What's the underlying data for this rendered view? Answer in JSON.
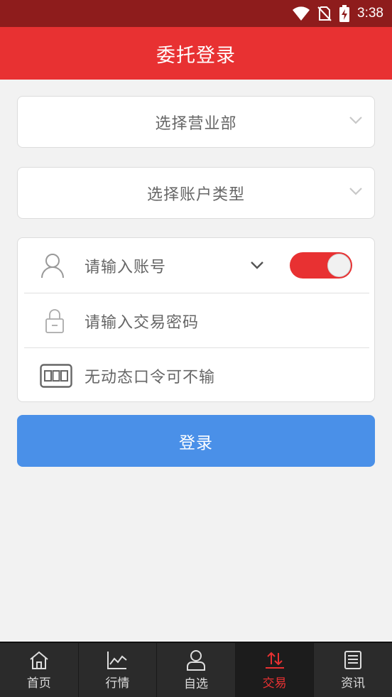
{
  "status_bar": {
    "time": "3:38"
  },
  "header": {
    "title": "委托登录"
  },
  "branch_select": {
    "label": "选择营业部"
  },
  "account_type_select": {
    "label": "选择账户类型"
  },
  "login_form": {
    "account_placeholder": "请输入账号",
    "password_placeholder": "请输入交易密码",
    "dynamic_token_placeholder": "无动态口令可不输",
    "remember_toggle_on": true
  },
  "login_button": {
    "label": "登录"
  },
  "colors": {
    "primary_red": "#e83132",
    "button_blue": "#4a90e8",
    "tabbar_bg": "#2b2b2b"
  },
  "tabbar": {
    "items": [
      {
        "label": "首页",
        "icon": "home-icon"
      },
      {
        "label": "行情",
        "icon": "chart-icon"
      },
      {
        "label": "自选",
        "icon": "person-icon"
      },
      {
        "label": "交易",
        "icon": "trade-arrows-icon",
        "active": true
      },
      {
        "label": "资讯",
        "icon": "news-icon"
      }
    ]
  }
}
